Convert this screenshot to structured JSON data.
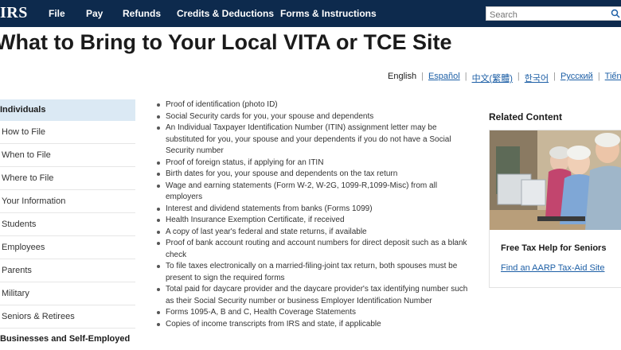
{
  "header": {
    "logo": "IRS",
    "nav": [
      {
        "label": "File"
      },
      {
        "label": "Pay"
      },
      {
        "label": "Refunds"
      },
      {
        "label": "Credits & Deductions"
      },
      {
        "label": "Forms & Instructions"
      }
    ],
    "search_placeholder": "Search"
  },
  "page": {
    "title": "What to Bring to Your Local VITA or TCE Site"
  },
  "languages": {
    "current": "English",
    "links": [
      "Español",
      "中文(繁體)",
      "한국어",
      "Русский",
      "Tiếng"
    ]
  },
  "sidebar": {
    "header": "Individuals",
    "items": [
      "How to File",
      "When to File",
      "Where to File",
      "Your Information",
      "Students",
      "Employees",
      "Parents",
      "Military",
      "Seniors & Retirees"
    ],
    "footer": "Businesses and Self-Employed"
  },
  "checklist": [
    "Proof of identification (photo ID)",
    "Social Security cards for you, your spouse and dependents",
    "An Individual Taxpayer Identification Number (ITIN) assignment letter may be substituted for you, your spouse and your dependents if you do not have a Social Security number",
    "Proof of foreign status, if applying for an ITIN",
    "Birth dates for you, your spouse and dependents on the tax return",
    "Wage and earning statements (Form W-2, W-2G, 1099-R,1099-Misc) from all employers",
    "Interest and dividend statements from banks (Forms 1099)",
    "Health Insurance Exemption Certificate, if received",
    "A copy of last year's federal and state returns, if available",
    "Proof of bank account routing and account numbers for direct deposit such as a blank check",
    "To file taxes electronically on a married-filing-joint tax return, both spouses must be present to sign the required forms",
    "Total paid for daycare provider and the daycare provider's tax identifying number such as their Social Security number or business Employer Identification Number",
    "Forms 1095-A, B and C, Health Coverage Statements",
    "Copies of income transcripts from IRS and state, if applicable"
  ],
  "related": {
    "title": "Related Content",
    "card_heading": "Free Tax Help for Seniors",
    "card_link": "Find an AARP Tax-Aid Site"
  }
}
